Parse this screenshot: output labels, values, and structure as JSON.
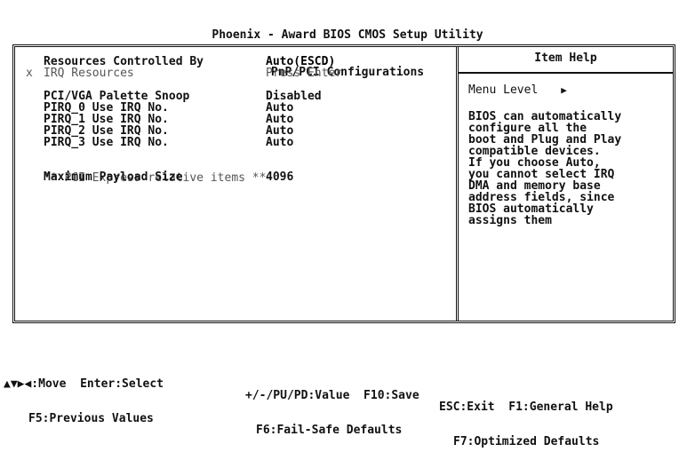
{
  "header": {
    "title": "Phoenix - Award BIOS CMOS Setup Utility",
    "subtitle": "PnP/PCI Configurations"
  },
  "settings": [
    {
      "label": "Resources Controlled By",
      "value": "Auto(ESCD)"
    },
    {
      "label": "IRQ Resources",
      "value": "Press Enter",
      "marker": "x"
    },
    {
      "label": "PCI/VGA Palette Snoop",
      "value": "Disabled"
    },
    {
      "label": "PIRQ_0 Use IRQ No.",
      "value": "Auto"
    },
    {
      "label": "PIRQ_1 Use IRQ No.",
      "value": "Auto"
    },
    {
      "label": "PIRQ_2 Use IRQ No.",
      "value": "Auto"
    },
    {
      "label": "PIRQ_3 Use IRQ No.",
      "value": "Auto"
    },
    {
      "label": "Maximum Payload Size",
      "value": "4096"
    }
  ],
  "section": {
    "pci_express": "** PCI Express relative items **"
  },
  "help": {
    "title": "Item Help",
    "menu_level": "Menu Level",
    "menu_level_arrow": "▶",
    "text": "BIOS can automatically\nconfigure all the\nboot and Plug and Play\ncompatible devices.\nIf you choose Auto,\nyou cannot select IRQ\nDMA and memory base\naddress fields, since\nBIOS automatically\nassigns them"
  },
  "footer": {
    "move": "▲▼▶◀:Move  Enter:Select",
    "value": "+/-/PU/PD:Value  F10:Save",
    "exit": "ESC:Exit  F1:General Help",
    "previous": "F5:Previous Values",
    "failsafe": "F6:Fail-Safe Defaults",
    "optimized": "F7:Optimized Defaults"
  }
}
